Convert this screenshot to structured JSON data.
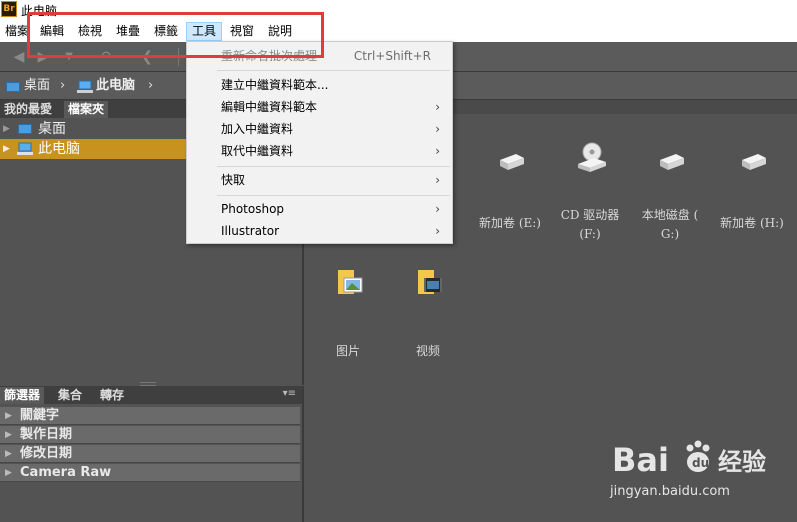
{
  "window": {
    "app_logo": "Br",
    "title": "此电脑"
  },
  "menubar": {
    "items": [
      "檔案",
      "編輯",
      "檢視",
      "堆疊",
      "標籤",
      "工具",
      "視窗",
      "說明"
    ],
    "active": "工具"
  },
  "path": {
    "items": [
      "桌面",
      "此电脑"
    ]
  },
  "left_panel": {
    "tabs": [
      "我的最愛",
      "檔案夾"
    ],
    "tree": [
      {
        "label": "桌面",
        "icon": "monitor-icon",
        "selected": false
      },
      {
        "label": "此电脑",
        "icon": "computer-icon",
        "selected": true
      }
    ]
  },
  "filter_panel": {
    "tabs": [
      "篩選器",
      "集合",
      "轉存"
    ],
    "rows": [
      "關鍵字",
      "製作日期",
      "修改日期",
      "Camera Raw"
    ]
  },
  "content": {
    "drives": [
      {
        "label1": ":)",
        "label2": ""
      },
      {
        "label1": "新加卷 (E:)",
        "label2": ""
      },
      {
        "label1": "CD 驱动器",
        "label2": "(F:)"
      },
      {
        "label1": "本地磁盘 (",
        "label2": "G:)"
      },
      {
        "label1": "新加卷 (H:)",
        "label2": ""
      }
    ],
    "folders": [
      {
        "label": "图片",
        "icon": "picture-folder-icon"
      },
      {
        "label": "视频",
        "icon": "video-folder-icon"
      }
    ]
  },
  "tools_menu": {
    "items": [
      {
        "label": "重新命名批次處理",
        "shortcut": "Ctrl+Shift+R",
        "disabled": true,
        "submenu": false
      },
      {
        "label": "建立中繼資料範本...",
        "shortcut": "",
        "disabled": false,
        "submenu": false
      },
      {
        "label": "編輯中繼資料範本",
        "shortcut": "",
        "disabled": false,
        "submenu": true
      },
      {
        "label": "加入中繼資料",
        "shortcut": "",
        "disabled": false,
        "submenu": true
      },
      {
        "label": "取代中繼資料",
        "shortcut": "",
        "disabled": false,
        "submenu": true
      },
      {
        "label": "快取",
        "shortcut": "",
        "disabled": false,
        "submenu": true
      },
      {
        "label": "Photoshop",
        "shortcut": "",
        "disabled": false,
        "submenu": true
      },
      {
        "label": "Illustrator",
        "shortcut": "",
        "disabled": false,
        "submenu": true
      }
    ]
  },
  "watermark": {
    "brand": "Bai",
    "suffix": "经验",
    "url": "jingyan.baidu.com"
  },
  "colors": {
    "highlight": "#e23b3b",
    "selection": "#c8921f",
    "menu_active": "#cde8ff"
  }
}
